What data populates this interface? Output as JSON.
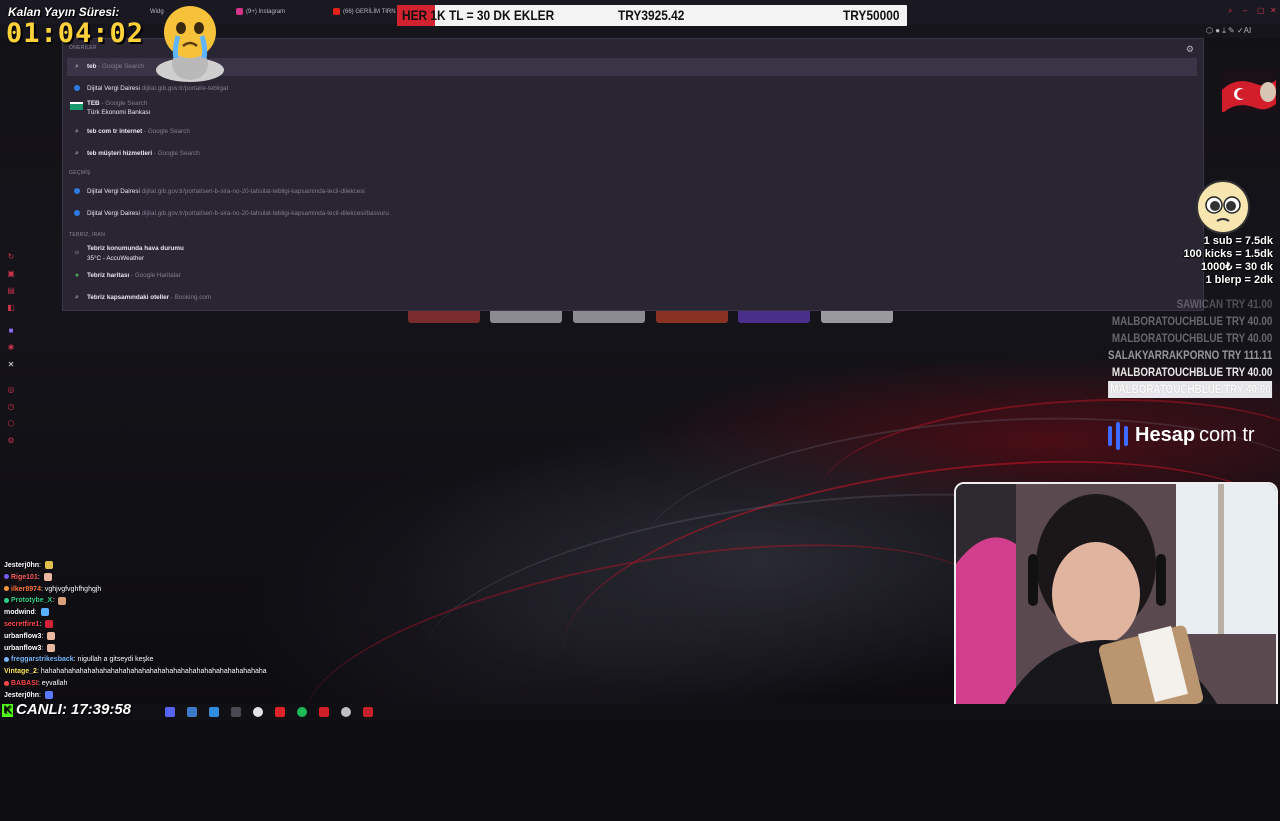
{
  "tabs": [
    {
      "label": "Widg"
    },
    {
      "label": "(9+) Instagram"
    },
    {
      "label": "(66) GERİLİM TIRN"
    }
  ],
  "banner": {
    "left": "HER 1K TL = 30 DK EKLER",
    "amount": "TRY3925.42",
    "goal": "TRY50000"
  },
  "timer": {
    "label": "Kalan Yayın Süresi:",
    "value": "01:04:02"
  },
  "dropdown": {
    "section_suggestions": "ÖNERİLER",
    "section_history": "GEÇMİŞ",
    "section_location": "TEBRİZ, İRAN",
    "rows": [
      {
        "query": "teb",
        "hint": "- Google Search"
      },
      {
        "title": "Dijital Vergi Dairesi",
        "url": "dijital.gib.gov.tr/portal/e-tebligat"
      },
      {
        "title": "TEB",
        "hint": "- Google Search",
        "subtitle": "Türk Ekonomi Bankası"
      },
      {
        "query": "teb com tr internet",
        "hint": "- Google Search"
      },
      {
        "query": "teb müşteri hizmetleri",
        "hint": "- Google Search"
      },
      {
        "title": "Dijital Vergi Dairesi",
        "url": "dijital.gib.gov.tr/portal/seri-b-sira-no-20-tahsilat-tebligi-kapsaminda-tecil-dilekcesi"
      },
      {
        "title": "Dijital Vergi Dairesi",
        "url": "dijital.gib.gov.tr/portal/seri-b-sira-no-20-tahsilat-tebligi-kapsaminda-tecil-dilekcesi/basvuru"
      },
      {
        "title": "Tebriz konumunda hava durumu",
        "subtitle": "35°C - AccuWeather"
      },
      {
        "query": "Tebriz haritası",
        "hint": "- Google Haritalar"
      },
      {
        "query": "Tebriz kapsamındaki oteller",
        "hint": "- Booking.com"
      }
    ]
  },
  "rates": [
    "1 sub = 7.5dk",
    "100 kicks = 1.5dk",
    "1000₺ = 30 dk",
    "1 blerp = 2dk"
  ],
  "donations": [
    {
      "name": "SAWICAN",
      "amount": "TRY 41.00"
    },
    {
      "name": "MALBORATOUCHBLUE",
      "amount": "TRY 40.00"
    },
    {
      "name": "MALBORATOUCHBLUE",
      "amount": "TRY 40.00"
    },
    {
      "name": "SALAKYARRAKPORNO",
      "amount": "TRY 111.11"
    },
    {
      "name": "MALBORATOUCHBLUE",
      "amount": "TRY 40.00"
    },
    {
      "name": "MALBORATOUCHBLUE",
      "amount": "TRY 40.00"
    }
  ],
  "sponsor": {
    "brand": "Hesap",
    "tld": "com tr"
  },
  "chat": [
    {
      "user": "Jesterj0hn",
      "text": "",
      "color": "#ffffff"
    },
    {
      "user": "Rige101",
      "text": "",
      "color": "#ff5e5e"
    },
    {
      "user": "ilker8974",
      "text": "vghjvgfvghfhghgjh",
      "color": "#ff7a3d"
    },
    {
      "user": "Prototybe_X",
      "text": "",
      "color": "#2fd18a"
    },
    {
      "user": "modwind",
      "text": "",
      "color": "#ffffff"
    },
    {
      "user": "secretfire1",
      "text": "",
      "color": "#ff4a4a"
    },
    {
      "user": "urbanflow3",
      "text": "",
      "color": "#ffffff"
    },
    {
      "user": "urbanflow3",
      "text": "",
      "color": "#ffffff"
    },
    {
      "user": "freggarstrikesback",
      "text": "nigullah a gitseydi keşke",
      "color": "#7ab8ff"
    },
    {
      "user": "Vintage_2",
      "text": "hahahahahahahahahahahahahahahahahahahahahahahahahahahahaha",
      "color": "#ffe95a"
    },
    {
      "user": "BABASI",
      "text": "eyvallah",
      "color": "#ff4a4a"
    },
    {
      "user": "Jesterj0hn",
      "text": "",
      "color": "#ffffff"
    }
  ],
  "live": {
    "label": "CANLI:",
    "time": "17:39:58"
  },
  "colors": {
    "accent": "#ffd23a",
    "brand_red": "#d3222f",
    "kick_green": "#53fc18",
    "dropdown_bg": "#2a2533"
  }
}
